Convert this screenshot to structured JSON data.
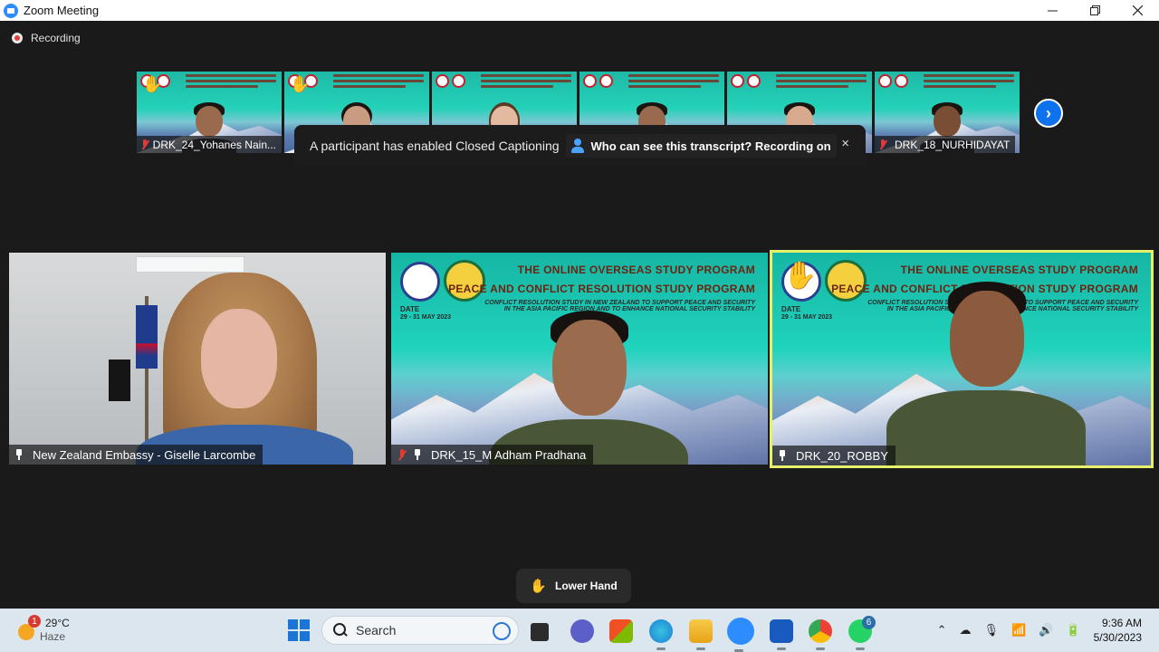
{
  "window": {
    "title": "Zoom Meeting"
  },
  "recording": {
    "label": "Recording"
  },
  "thumbnails": [
    {
      "name": "DRK_24_Yohanes Nain...",
      "hand": true
    },
    {
      "name": "",
      "hand": true
    },
    {
      "name": "",
      "hand": false
    },
    {
      "name": "",
      "hand": false
    },
    {
      "name": "",
      "hand": false
    },
    {
      "name": "DRK_18_NURHIDAYAT",
      "hand": false
    }
  ],
  "thumb_name_visible": [
    "DRK_24_Yohanes Nain...",
    "DRK_18_NURHIDAYAT"
  ],
  "toast": {
    "message": "A participant has enabled Closed Captioning",
    "link": "Who can see this transcript? Recording on",
    "close": "×"
  },
  "banner": {
    "title1": "THE ONLINE OVERSEAS STUDY PROGRAM",
    "title2": "PEACE AND CONFLICT RESOLUTION STUDY PROGRAM",
    "subtitle": "CONFLICT RESOLUTION STUDY IN NEW ZEALAND TO SUPPORT PEACE AND SECURITY IN THE ASIA PACIFIC REGION AND TO ENHANCE NATIONAL SECURITY STABILITY",
    "date_label": "DATE",
    "date_value": "29 - 31 MAY 2023"
  },
  "tiles": {
    "t1": {
      "name": "New Zealand Embassy - Giselle Larcombe"
    },
    "t2": {
      "name": "DRK_15_M Adham Pradhana"
    },
    "t3": {
      "name": "DRK_20_ROBBY"
    }
  },
  "lower_hand": {
    "label": "Lower Hand"
  },
  "taskbar": {
    "weather": {
      "temp": "29°C",
      "condition": "Haze",
      "badge": "1"
    },
    "search_placeholder": "Search",
    "whatsapp_badge": "6",
    "time": "9:36 AM",
    "date": "5/30/2023"
  },
  "colors": {
    "zoom_blue": "#0e72ed",
    "active_speaker": "#e6f06a",
    "taskbar": "#dce6ee"
  }
}
